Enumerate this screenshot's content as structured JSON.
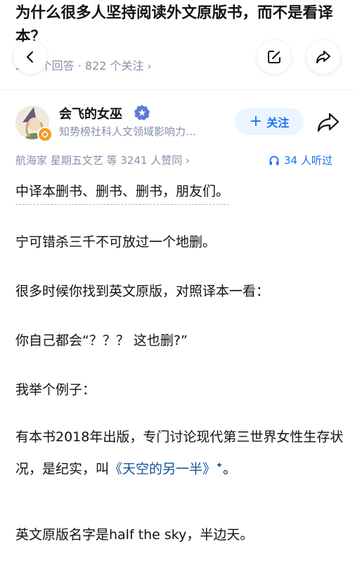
{
  "question": {
    "title": "为什么很多人坚持阅读外文原版书，而不是看译本？",
    "meta": "238 个回答 · 822 个关注",
    "meta_chevron": "›"
  },
  "author": {
    "name": "会飞的女巫",
    "bio": "知势榜社科人文领域影响力…",
    "follow_label": "关注",
    "follow_plus": "+"
  },
  "stats": {
    "endorse": "航海家 星期五文艺 等 3241 人赞同",
    "endorse_chevron": "›",
    "listen": "34 人听过"
  },
  "answer": {
    "p1": "中译本删书、删书、删书，朋友们。",
    "p2": "宁可错杀三千不可放过一个地删。",
    "p3": "很多时候你找到英文原版，对照译本一看：",
    "p4": "你自己都会“？？？ 这也删?”",
    "p5": "我举个例子：",
    "p6_prefix": "有本书2018年出版，专门讨论现代第三世界女性生存状况，是纪实，叫",
    "p6_link": "《天空的另一半》",
    "p6_sparkle": "✦",
    "p6_suffix": "。",
    "p7": "英文原版名字是half the sky，半边天。"
  },
  "icons": {
    "back": "chevron-left-icon",
    "edit": "edit-icon",
    "share": "share-icon",
    "verified": "verified-badge-icon",
    "headphones": "headphones-icon"
  },
  "colors": {
    "accent": "#1772f6",
    "link": "#175199",
    "muted": "#8590a6"
  }
}
